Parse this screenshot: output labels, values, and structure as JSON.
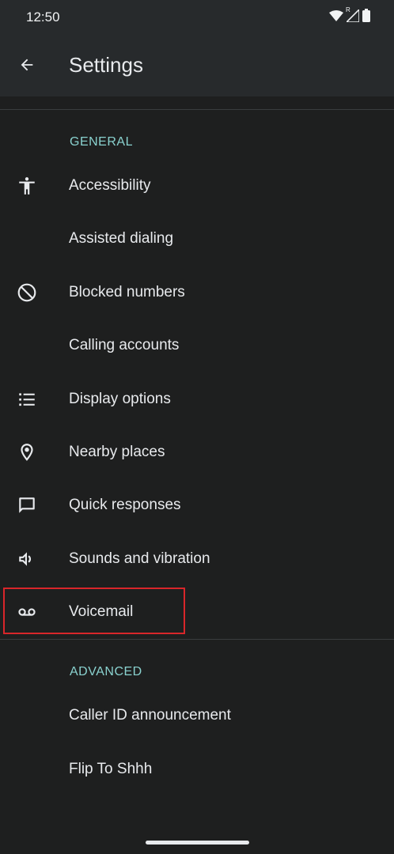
{
  "status_bar": {
    "time": "12:50",
    "roaming_indicator": "R"
  },
  "header": {
    "title": "Settings"
  },
  "sections": {
    "general": {
      "title": "GENERAL",
      "items": [
        {
          "label": "Accessibility",
          "icon": "accessibility-icon"
        },
        {
          "label": "Assisted dialing",
          "icon": ""
        },
        {
          "label": "Blocked numbers",
          "icon": "block-icon"
        },
        {
          "label": "Calling accounts",
          "icon": ""
        },
        {
          "label": "Display options",
          "icon": "list-icon"
        },
        {
          "label": "Nearby places",
          "icon": "location-pin-icon"
        },
        {
          "label": "Quick responses",
          "icon": "chat-bubble-icon"
        },
        {
          "label": "Sounds and vibration",
          "icon": "volume-icon"
        },
        {
          "label": "Voicemail",
          "icon": "voicemail-icon",
          "highlighted": true
        }
      ]
    },
    "advanced": {
      "title": "ADVANCED",
      "items": [
        {
          "label": "Caller ID announcement"
        },
        {
          "label": "Flip To Shhh"
        }
      ]
    }
  },
  "colors": {
    "background": "#1e1f1f",
    "appbar": "#272a2c",
    "accent": "#8ad2cf",
    "highlight": "#d9262a"
  }
}
